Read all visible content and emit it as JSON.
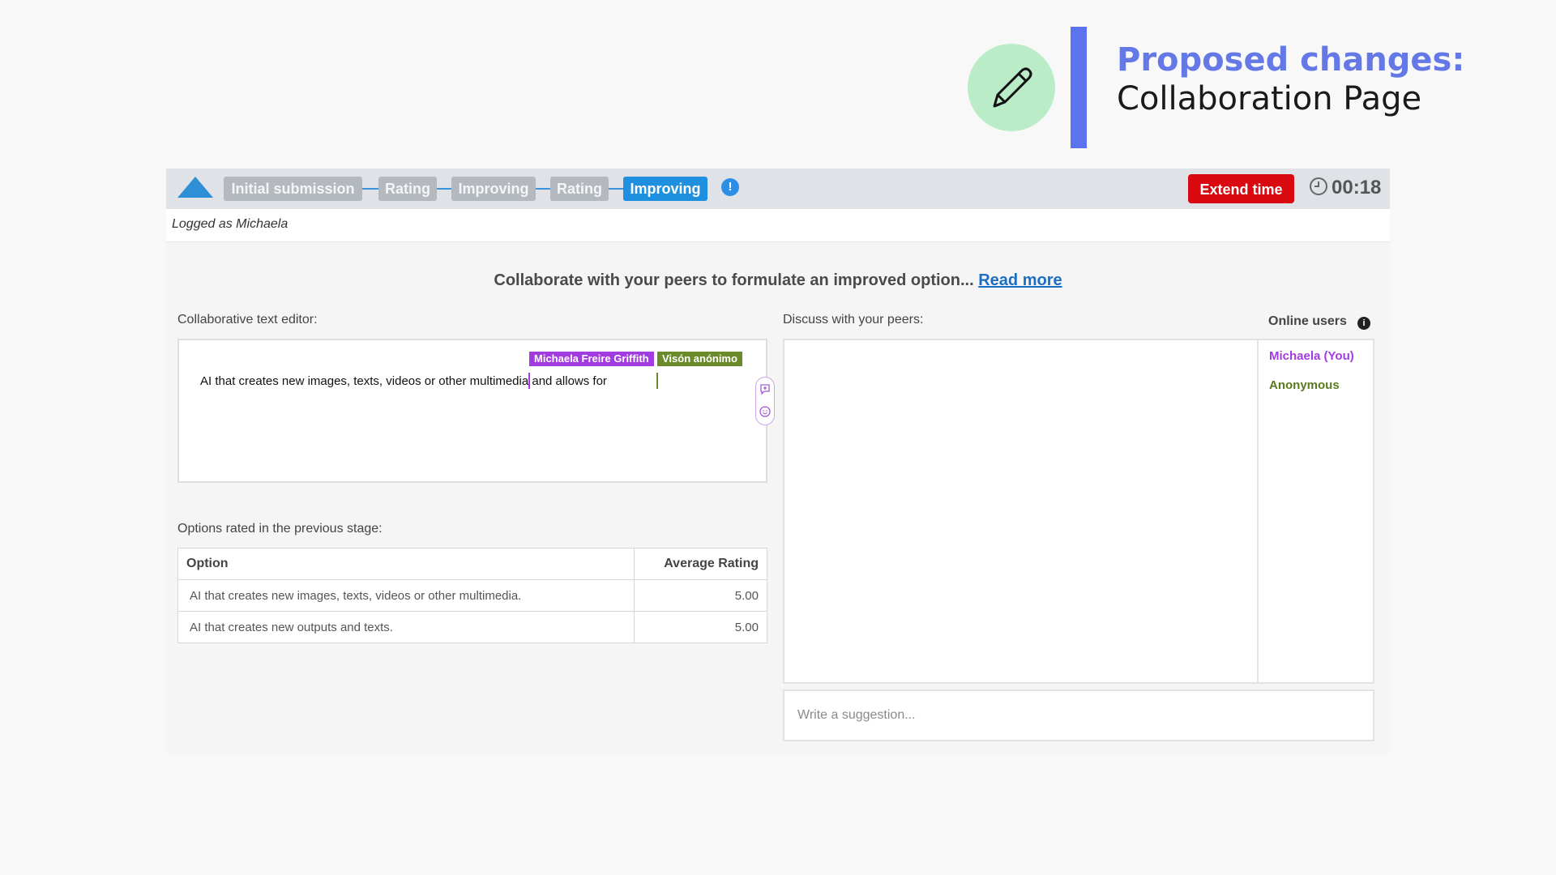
{
  "slide": {
    "title_accent": "Proposed changes:",
    "title_main": "Collaboration Page",
    "icon": "pencil-icon"
  },
  "app": {
    "stages": [
      {
        "label": "Initial submission",
        "active": false
      },
      {
        "label": "Rating",
        "active": false
      },
      {
        "label": "Improving",
        "active": false
      },
      {
        "label": "Rating",
        "active": false
      },
      {
        "label": "Improving",
        "active": true
      }
    ],
    "info_glyph": "!",
    "extend_time_label": "Extend time",
    "timer": "00:18",
    "logged_as": "Logged as Michaela",
    "instruction_text": "Collaborate with your peers to formulate an improved option...",
    "read_more": "Read more",
    "editor": {
      "label": "Collaborative text editor:",
      "text_before_cursor": "AI that creates new images, texts, videos or other multi",
      "text_after_cursor": "media and allows for ",
      "cursors": [
        {
          "name": "Michaela Freire Griffith",
          "color": "#a23be0"
        },
        {
          "name": "Visón anónimo",
          "color": "#6b8a2a"
        }
      ]
    },
    "options": {
      "label": "Options rated in the previous stage:",
      "headers": [
        "Option",
        "Average Rating"
      ],
      "rows": [
        {
          "option": "AI that creates new images, texts, videos or other multimedia.",
          "rating": "5.00"
        },
        {
          "option": "AI that creates new outputs and texts.",
          "rating": "5.00"
        }
      ]
    },
    "discussion": {
      "label": "Discuss with your peers:",
      "online_title": "Online users",
      "online_info_glyph": "i",
      "users": [
        {
          "name": "Michaela (You)",
          "color": "#a23be0"
        },
        {
          "name": "Anonymous",
          "color": "#5b7a1e"
        }
      ],
      "suggestion_placeholder": "Write a suggestion..."
    }
  },
  "colors": {
    "accent_blue": "#5b74ee",
    "active_stage": "#1f8fe0",
    "extend_red": "#d8090f",
    "pen_circle": "#b9ecc7"
  }
}
